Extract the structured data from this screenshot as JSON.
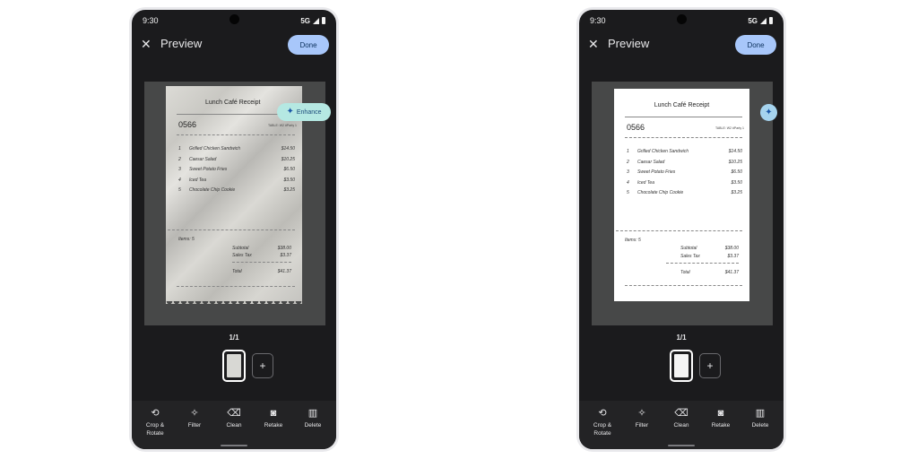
{
  "status": {
    "time": "9:30",
    "network": "5G"
  },
  "header": {
    "title": "Preview",
    "done_label": "Done"
  },
  "enhance": {
    "label": "Enhance"
  },
  "receipt": {
    "title": "Lunch Café Receipt",
    "number": "0566",
    "meta": "TABLE: W2   #Party 1",
    "items": [
      {
        "n": "1",
        "name": "Grilled Chicken Sandwich",
        "price": "$14.50"
      },
      {
        "n": "2",
        "name": "Caesar Salad",
        "price": "$10.25"
      },
      {
        "n": "3",
        "name": "Sweet Potato Fries",
        "price": "$6.50"
      },
      {
        "n": "4",
        "name": "Iced Tea",
        "price": "$3.50"
      },
      {
        "n": "5",
        "name": "Chocolate Chip Cookie",
        "price": "$3.25"
      }
    ],
    "item_count": "Items: 5",
    "subtotal_label": "Subtotal",
    "subtotal": "$38.00",
    "tax_label": "Sales Tax",
    "tax": "$3.37",
    "total_label": "Total",
    "total": "$41.37"
  },
  "pager": {
    "indicator": "1/1",
    "add_symbol": "+"
  },
  "toolbar": {
    "crop_label": "Crop & Rotate",
    "filter_label": "Filter",
    "clean_label": "Clean",
    "retake_label": "Retake",
    "delete_label": "Delete"
  },
  "icons": {
    "close": "close-icon",
    "enhance": "sparkle-icon",
    "crop": "crop-rotate-icon",
    "filter": "magic-wand-icon",
    "clean": "eraser-icon",
    "retake": "camera-icon",
    "delete": "trash-icon"
  },
  "colors": {
    "accent": "#a8c7fa",
    "enhance_pill": "#b5e8e2",
    "screen_bg": "#1b1b1d",
    "toolbar_bg": "#232325"
  }
}
